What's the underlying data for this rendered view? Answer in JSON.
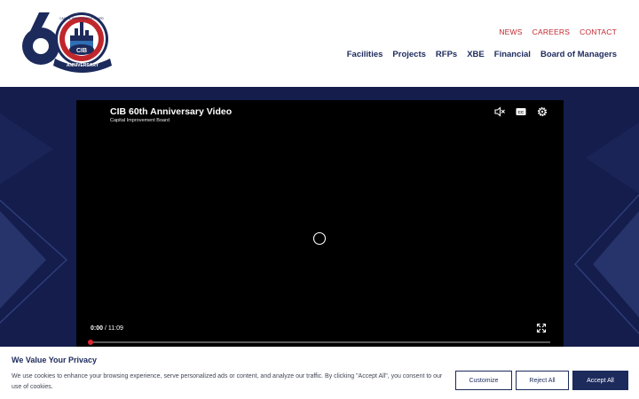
{
  "header": {
    "logo_text": "CIB",
    "logo_banner": "ANNIVERSARY",
    "logo_number": "60",
    "logo_ring_text": "CAPITAL IMPROVEMENT BOARD",
    "top_links": [
      "NEWS",
      "CAREERS",
      "CONTACT"
    ],
    "nav_items": [
      "Facilities",
      "Projects",
      "RFPs",
      "XBE",
      "Financial",
      "Board of Managers"
    ]
  },
  "video": {
    "title": "CIB 60th Anniversary Video",
    "subtitle": "Capital Improvement Board",
    "current_time": "0:00",
    "separator": "/",
    "duration": "11:09",
    "progress": 0,
    "icons": [
      "mute-icon",
      "captions-icon",
      "settings-icon",
      "fullscreen-icon",
      "loading-spinner-icon"
    ]
  },
  "cookie": {
    "title": "We Value Your Privacy",
    "text": "We use cookies to enhance your browsing experience, serve personalized ads or content, and analyze our traffic. By clicking \"Accept All\", you consent to our use of cookies.",
    "customize_label": "Customize",
    "reject_label": "Reject All",
    "accept_label": "Accept All"
  },
  "colors": {
    "navy": "#1c2a5c",
    "red": "#c0272d",
    "hero_bg": "#141d4c"
  }
}
